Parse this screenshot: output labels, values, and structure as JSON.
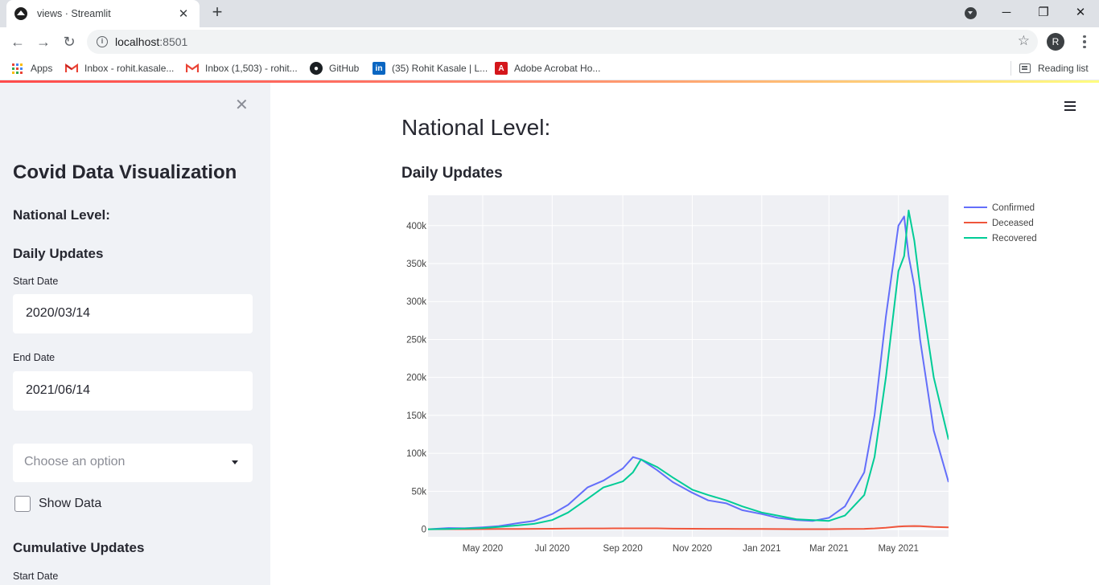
{
  "browser": {
    "tab_title": "views · Streamlit",
    "url_host": "localhost",
    "url_port": ":8501",
    "profile_initial": "R",
    "bookmarks": [
      {
        "label": "Apps",
        "icon": "apps-grid-icon"
      },
      {
        "label": "Inbox - rohit.kasale...",
        "icon": "gmail-icon"
      },
      {
        "label": "Inbox (1,503) - rohit...",
        "icon": "gmail-icon"
      },
      {
        "label": "GitHub",
        "icon": "github-icon"
      },
      {
        "label": "(35) Rohit Kasale | L...",
        "icon": "linkedin-icon"
      },
      {
        "label": "Adobe Acrobat Ho...",
        "icon": "acrobat-icon"
      }
    ],
    "reading_list": "Reading list"
  },
  "sidebar": {
    "title": "Covid Data Visualization",
    "national_heading": "National Level:",
    "daily_heading": "Daily Updates",
    "start_label": "Start Date",
    "start_value": "2020/03/14",
    "end_label": "End Date",
    "end_value": "2021/06/14",
    "select_placeholder": "Choose an option",
    "show_data_label": "Show Data",
    "cumulative_heading": "Cumulative Updates",
    "start_label_2": "Start Date"
  },
  "main": {
    "title": "National Level:",
    "subtitle": "Daily Updates"
  },
  "colors": {
    "confirmed": "#636efa",
    "deceased": "#ef553b",
    "recovered": "#00cc96",
    "plot_bg": "#eff0f4"
  },
  "chart_data": {
    "type": "line",
    "title": "",
    "xlabel": "",
    "ylabel": "",
    "x_range": [
      "2020-03-14",
      "2021-06-14"
    ],
    "ylim": [
      -10000,
      440000
    ],
    "y_ticks": [
      0,
      50000,
      100000,
      150000,
      200000,
      250000,
      300000,
      350000,
      400000
    ],
    "y_tick_labels": [
      "0",
      "50k",
      "100k",
      "150k",
      "200k",
      "250k",
      "300k",
      "350k",
      "400k"
    ],
    "x_ticks": [
      "2020-05-01",
      "2020-07-01",
      "2020-09-01",
      "2020-11-01",
      "2021-01-01",
      "2021-03-01",
      "2021-05-01"
    ],
    "x_tick_labels": [
      "May 2020",
      "Jul 2020",
      "Sep 2020",
      "Nov 2020",
      "Jan 2021",
      "Mar 2021",
      "May 2021"
    ],
    "legend_position": "top-right",
    "grid": true,
    "x": [
      "2020-03-14",
      "2020-04-01",
      "2020-04-15",
      "2020-05-01",
      "2020-05-15",
      "2020-06-01",
      "2020-06-15",
      "2020-07-01",
      "2020-07-15",
      "2020-08-01",
      "2020-08-15",
      "2020-09-01",
      "2020-09-10",
      "2020-09-17",
      "2020-10-01",
      "2020-10-15",
      "2020-11-01",
      "2020-11-15",
      "2020-12-01",
      "2020-12-15",
      "2021-01-01",
      "2021-01-15",
      "2021-02-01",
      "2021-02-15",
      "2021-03-01",
      "2021-03-15",
      "2021-04-01",
      "2021-04-10",
      "2021-04-20",
      "2021-05-01",
      "2021-05-06",
      "2021-05-10",
      "2021-05-15",
      "2021-05-20",
      "2021-06-01",
      "2021-06-14"
    ],
    "series": [
      {
        "name": "Confirmed",
        "color": "#636efa",
        "values": [
          0,
          1500,
          1200,
          2500,
          4000,
          8000,
          11000,
          20000,
          32000,
          55000,
          64000,
          80000,
          95000,
          92000,
          78000,
          62000,
          48000,
          38000,
          34000,
          25000,
          20000,
          15000,
          12000,
          11000,
          15000,
          30000,
          75000,
          150000,
          280000,
          400000,
          412000,
          360000,
          320000,
          250000,
          130000,
          62000
        ]
      },
      {
        "name": "Deceased",
        "color": "#ef553b",
        "values": [
          0,
          50,
          100,
          200,
          300,
          400,
          500,
          600,
          800,
          1000,
          1000,
          1100,
          1150,
          1150,
          1100,
          700,
          550,
          500,
          480,
          300,
          250,
          150,
          100,
          100,
          100,
          250,
          450,
          1000,
          2000,
          3500,
          3900,
          4000,
          4200,
          4000,
          3000,
          2500
        ]
      },
      {
        "name": "Recovered",
        "color": "#00cc96",
        "values": [
          0,
          300,
          800,
          1500,
          3000,
          5000,
          7000,
          12000,
          22000,
          40000,
          55000,
          63000,
          75000,
          92000,
          82000,
          68000,
          52000,
          45000,
          38000,
          30000,
          22000,
          18000,
          13000,
          12000,
          11000,
          18000,
          45000,
          95000,
          200000,
          340000,
          360000,
          420000,
          380000,
          320000,
          200000,
          118000
        ]
      }
    ]
  }
}
